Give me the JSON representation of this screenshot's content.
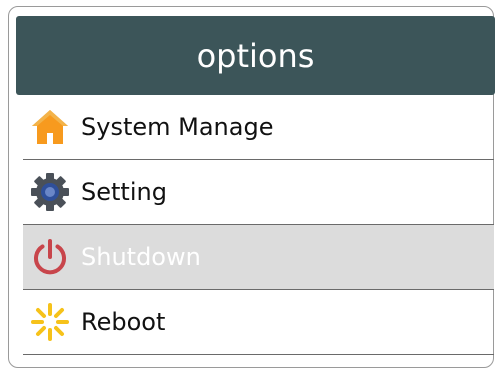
{
  "header": {
    "title": "options"
  },
  "menu": {
    "items": [
      {
        "label": "System Manage",
        "icon": "home-icon",
        "enabled": true
      },
      {
        "label": "Setting",
        "icon": "gear-icon",
        "enabled": true
      },
      {
        "label": "Shutdown",
        "icon": "power-icon",
        "enabled": false
      },
      {
        "label": "Reboot",
        "icon": "reboot-sun-icon",
        "enabled": true
      }
    ]
  },
  "colors": {
    "header_bg": "#3c5559",
    "disabled_bg": "#dcdcdc",
    "home_orange": "#f79a1e",
    "gear_blue": "#2f4f9a",
    "power_red": "#c8454b",
    "reboot_yellow": "#f6c21a"
  }
}
